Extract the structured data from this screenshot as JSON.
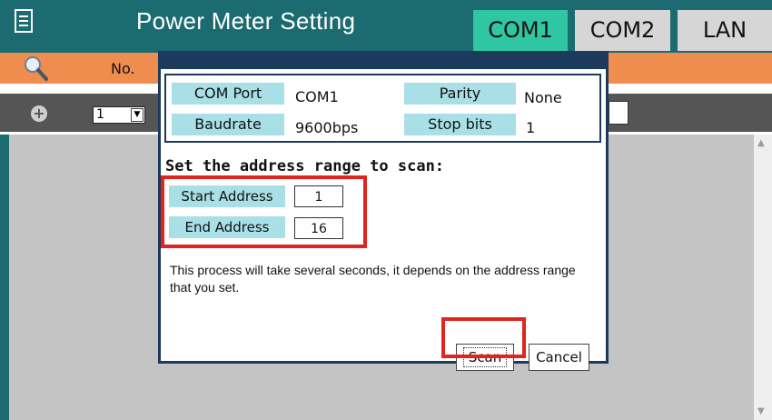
{
  "header": {
    "title": "Power Meter Setting",
    "tabs": [
      {
        "label": "COM1",
        "active": true
      },
      {
        "label": "COM2",
        "active": false
      },
      {
        "label": "LAN",
        "active": false
      }
    ]
  },
  "toolbar": {
    "no_label": "No.",
    "selected_no": "1"
  },
  "dialog": {
    "com_port_label": "COM Port",
    "com_port_value": "COM1",
    "parity_label": "Parity",
    "parity_value": "None",
    "baudrate_label": "Baudrate",
    "baudrate_value": "9600bps",
    "stop_bits_label": "Stop bits",
    "stop_bits_value": "1",
    "range_title": "Set the address range to scan:",
    "start_label": "Start Address",
    "start_value": "1",
    "end_label": "End Address",
    "end_value": "16",
    "description": "This process will take several seconds, it depends on the address range that you set.",
    "scan_label": "Scan",
    "cancel_label": "Cancel"
  },
  "colors": {
    "titlebar": "#1b6b70",
    "active_tab": "#2fc6a3",
    "orange_header": "#ef8d4e",
    "label_bg": "#a9dfe6",
    "highlight": "#e1241e"
  },
  "icons": [
    "menu-icon",
    "search-icon",
    "add-icon",
    "dropdown-arrow-icon",
    "scroll-up-icon",
    "scroll-down-icon"
  ]
}
